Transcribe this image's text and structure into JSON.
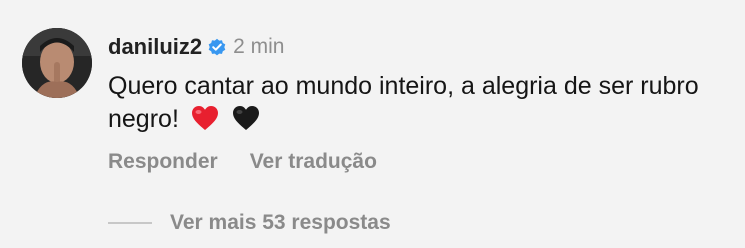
{
  "comment": {
    "username": "daniluiz2",
    "verified_icon": "verified-badge-icon",
    "time": "2 min",
    "text": "Quero cantar ao mundo inteiro, a alegria de ser rubro negro!",
    "emojis": [
      "red-heart-icon",
      "black-heart-icon"
    ],
    "colors": {
      "background": "#f3f3f3",
      "verified": "#3897f0",
      "muted": "#8a8a8a",
      "heart_red": "#e8202f",
      "heart_black": "#1a1a1a"
    }
  },
  "actions": {
    "reply_label": "Responder",
    "translate_label": "Ver tradução"
  },
  "replies": {
    "label": "Ver mais 53 respostas"
  }
}
